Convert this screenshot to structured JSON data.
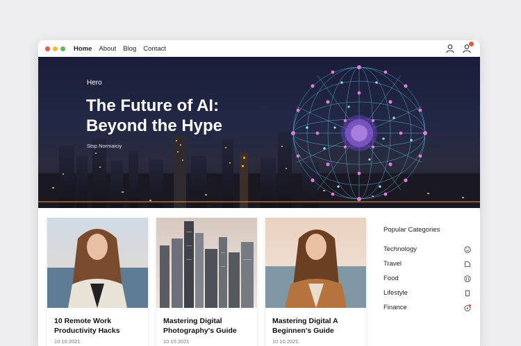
{
  "header": {
    "nav": [
      {
        "label": "Home"
      },
      {
        "label": "About"
      },
      {
        "label": "Blog"
      },
      {
        "label": "Contact"
      }
    ],
    "colors": {
      "red": "#e5584b",
      "yellow": "#f0b93a",
      "green": "#5cb85c",
      "badge": "#e4593b"
    }
  },
  "hero": {
    "label": "Hero",
    "title": "The Future of AI: Beyond the Hype",
    "subtitle": "Stsp Normaiciy"
  },
  "posts": [
    {
      "title": "10 Remote Work Productivity Hacks",
      "date": "10 10 2021"
    },
    {
      "title": "Mastering Digital Photography's Guide",
      "date": "10 10 2021"
    },
    {
      "title": "Mastering Digital A Beginnen's Guide",
      "date": "10 10 2021"
    }
  ],
  "sidebar": {
    "title": "Popular Categories",
    "categories": [
      {
        "label": "Technology",
        "icon": "smiley-icon"
      },
      {
        "label": "Travel",
        "icon": "tag-icon"
      },
      {
        "label": "Food",
        "icon": "food-icon"
      },
      {
        "label": "Lifestyle",
        "icon": "bookmark-icon"
      },
      {
        "label": "Finance",
        "icon": "finance-icon"
      }
    ]
  }
}
